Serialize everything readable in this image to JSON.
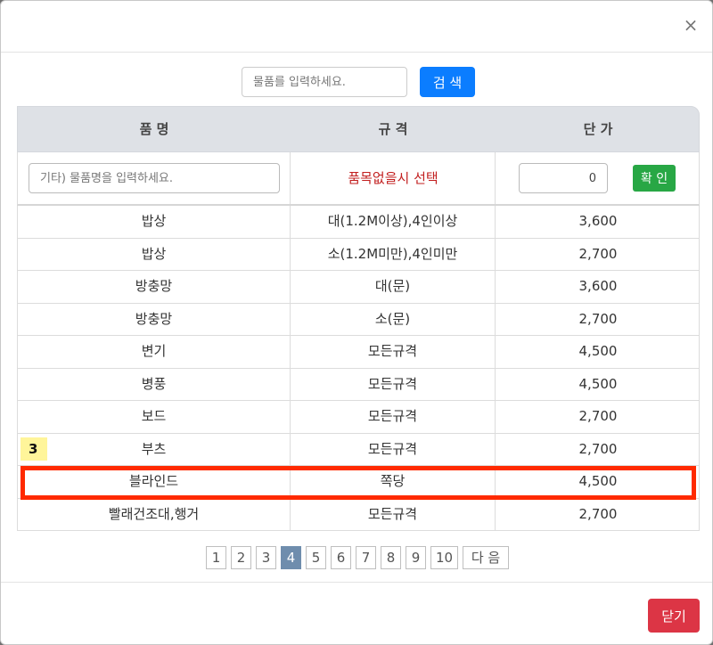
{
  "header": {
    "close_glyph": "×"
  },
  "search": {
    "placeholder": "물품를 입력하세요.",
    "button_label": "검 색"
  },
  "table": {
    "columns": [
      "품 명",
      "규 격",
      "단 가"
    ],
    "entry": {
      "name_placeholder": "기타) 물품명을 입력하세요.",
      "spec_text": "품목없을시 선택",
      "price_value": "0",
      "confirm_label": "확 인"
    },
    "rows": [
      {
        "name": "밥상",
        "spec": "대(1.2M이상),4인이상",
        "price": "3,600"
      },
      {
        "name": "밥상",
        "spec": "소(1.2M미만),4인미만",
        "price": "2,700"
      },
      {
        "name": "방충망",
        "spec": "대(문)",
        "price": "3,600"
      },
      {
        "name": "방충망",
        "spec": "소(문)",
        "price": "2,700"
      },
      {
        "name": "변기",
        "spec": "모든규격",
        "price": "4,500"
      },
      {
        "name": "병풍",
        "spec": "모든규격",
        "price": "4,500"
      },
      {
        "name": "보드",
        "spec": "모든규격",
        "price": "2,700"
      },
      {
        "name": "부츠",
        "spec": "모든규격",
        "price": "2,700"
      },
      {
        "name": "블라인드",
        "spec": "쪽당",
        "price": "4,500"
      },
      {
        "name": "빨래건조대,행거",
        "spec": "모든규격",
        "price": "2,700"
      }
    ]
  },
  "annotation": {
    "step_label": "3",
    "highlight_color": "#ff2a00"
  },
  "pagination": {
    "pages": [
      "1",
      "2",
      "3",
      "4",
      "5",
      "6",
      "7",
      "8",
      "9",
      "10"
    ],
    "active": "4",
    "next_label": "다 음"
  },
  "footer": {
    "close_label": "닫기"
  },
  "colors": {
    "primary": "#0b7dff",
    "success": "#28a745",
    "danger": "#dc3545",
    "active_page": "#6f8dad"
  }
}
